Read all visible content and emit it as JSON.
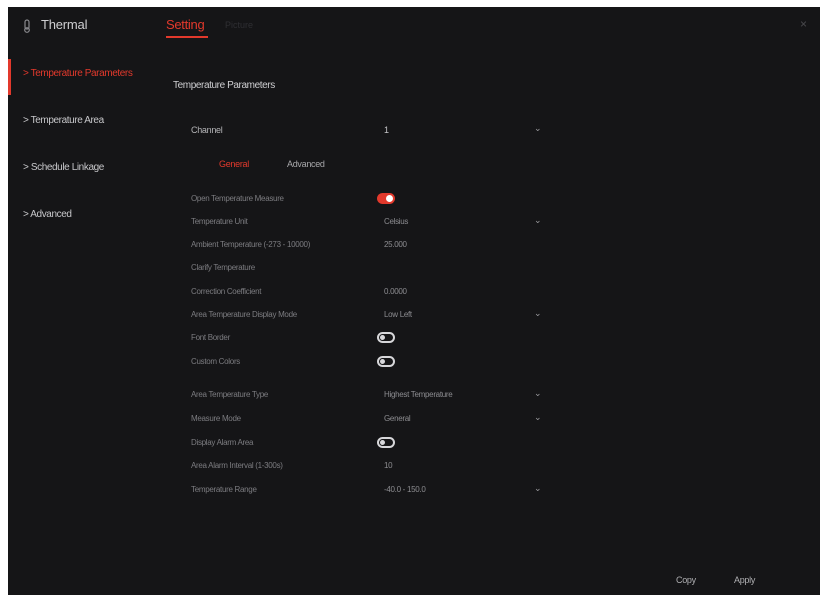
{
  "app": {
    "title": "Thermal"
  },
  "header": {
    "tab_setting": "Setting",
    "tab_other": "Picture",
    "close": "×"
  },
  "sidebar": {
    "items": [
      {
        "label": "> Temperature Parameters"
      },
      {
        "label": "> Temperature Area"
      },
      {
        "label": "> Schedule Linkage"
      },
      {
        "label": "> Advanced"
      }
    ]
  },
  "main": {
    "section_title": "Temperature Parameters",
    "channel": {
      "label": "Channel",
      "value": "1"
    },
    "subtabs": {
      "general": "General",
      "advanced": "Advanced"
    },
    "rows": {
      "open_measure": {
        "label": "Open Temperature Measure",
        "state": "on"
      },
      "unit": {
        "label": "Temperature Unit",
        "value": "Celsius"
      },
      "ambient": {
        "label": "Ambient Temperature (-273 - 10000)",
        "value": "25.000"
      },
      "clarify": {
        "label": "Clarify Temperature"
      },
      "correction": {
        "label": "Correction Coefficient",
        "value": "0.0000"
      },
      "display_mode": {
        "label": "Area Temperature Display Mode",
        "value": "Low Left"
      },
      "font_border": {
        "label": "Font Border",
        "state": "off"
      },
      "custom_colors": {
        "label": "Custom Colors",
        "state": "off"
      },
      "temp_type": {
        "label": "Area Temperature Type",
        "value": "Highest Temperature"
      },
      "measure_mode": {
        "label": "Measure Mode",
        "value": "General"
      },
      "alarm_area": {
        "label": "Display Alarm Area",
        "state": "off"
      },
      "alarm_interval": {
        "label": "Area Alarm Interval (1-300s)",
        "value": "10"
      },
      "temp_range": {
        "label": "Temperature Range",
        "value": "-40.0 - 150.0"
      }
    }
  },
  "footer": {
    "copy": "Copy",
    "apply": "Apply"
  },
  "colors": {
    "accent": "#e2392c",
    "background": "#151517"
  }
}
